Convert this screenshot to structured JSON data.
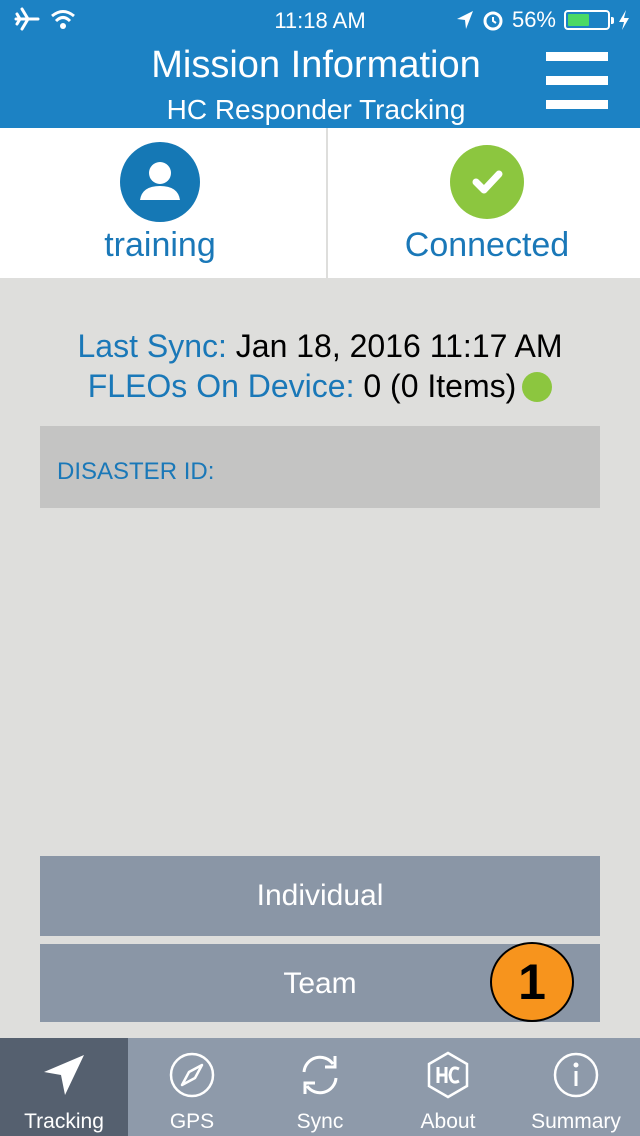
{
  "status_bar": {
    "time": "11:18 AM",
    "battery_percent": "56%",
    "battery_level": 0.56
  },
  "header": {
    "title": "Mission Information",
    "subtitle": "HC Responder Tracking"
  },
  "panels": {
    "user_label": "training",
    "connection_label": "Connected"
  },
  "sync": {
    "last_sync_label": "Last Sync:",
    "last_sync_value": "Jan 18, 2016 11:17 AM",
    "fleos_label": "FLEOs On Device:",
    "fleos_value": "0 (0 Items)"
  },
  "disaster": {
    "label": "DISASTER ID:"
  },
  "buttons": {
    "individual": "Individual",
    "team": "Team"
  },
  "badge": "1",
  "colors": {
    "header": "#1c82c4",
    "accent_blue": "#1a78b8",
    "green": "#8cc63f",
    "button": "#8a96a6",
    "badge": "#f7941d"
  },
  "tabs": [
    {
      "label": "Tracking",
      "icon": "navigation-arrow-icon",
      "active": true
    },
    {
      "label": "GPS",
      "icon": "compass-icon",
      "active": false
    },
    {
      "label": "Sync",
      "icon": "sync-icon",
      "active": false
    },
    {
      "label": "About",
      "icon": "hc-logo-icon",
      "active": false
    },
    {
      "label": "Summary",
      "icon": "info-icon",
      "active": false
    }
  ]
}
